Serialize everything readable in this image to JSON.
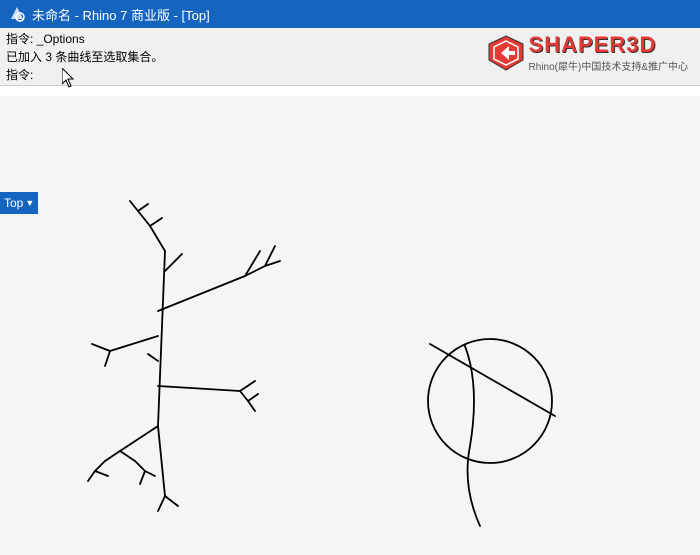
{
  "titlebar": {
    "text": "未命名 - Rhino 7 商业版 - [Top]"
  },
  "command": {
    "line1": "指令: _Options",
    "line2": "已加入 3 条曲线至选取集合。",
    "line3_label": "指令:"
  },
  "viewport": {
    "label": "Top",
    "dropdown_arrow": "▼"
  },
  "logo": {
    "shaper": "SHAPER3D",
    "subtitle": "Rhino(犀牛)中国技术支持&推广中心",
    "icon_shape": "diamond"
  }
}
